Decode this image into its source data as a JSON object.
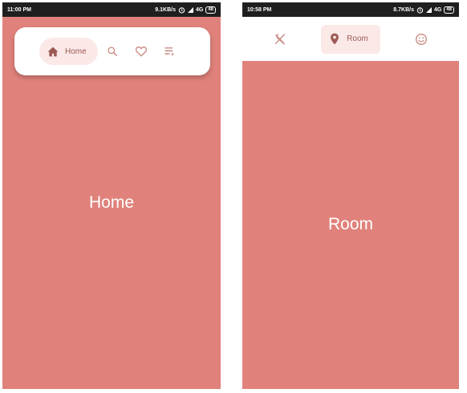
{
  "left_screen": {
    "status": {
      "time": "11:00 PM",
      "speed": "9.1KB/s",
      "network": "4G",
      "battery": "48"
    },
    "nav": {
      "items": [
        {
          "label": "Home",
          "icon": "home-icon",
          "active": true
        },
        {
          "label": "",
          "icon": "search-icon",
          "active": false
        },
        {
          "label": "",
          "icon": "heart-icon",
          "active": false
        },
        {
          "label": "",
          "icon": "playlist-icon",
          "active": false
        }
      ]
    },
    "content_title": "Home"
  },
  "right_screen": {
    "status": {
      "time": "10:58 PM",
      "speed": "8.7KB/s",
      "network": "4G",
      "battery": "48"
    },
    "nav": {
      "items": [
        {
          "label": "",
          "icon": "restaurant-icon",
          "active": false
        },
        {
          "label": "Room",
          "icon": "location-pin-icon",
          "active": true
        },
        {
          "label": "",
          "icon": "smiley-icon",
          "active": false
        }
      ]
    },
    "content_title": "Room"
  },
  "colors": {
    "page_background": "#e0827b",
    "pill_background": "#fbe9e7",
    "active_tint": "#9c5a55",
    "icon_tint": "#c98880",
    "status_bar": "#1f1f1f"
  }
}
